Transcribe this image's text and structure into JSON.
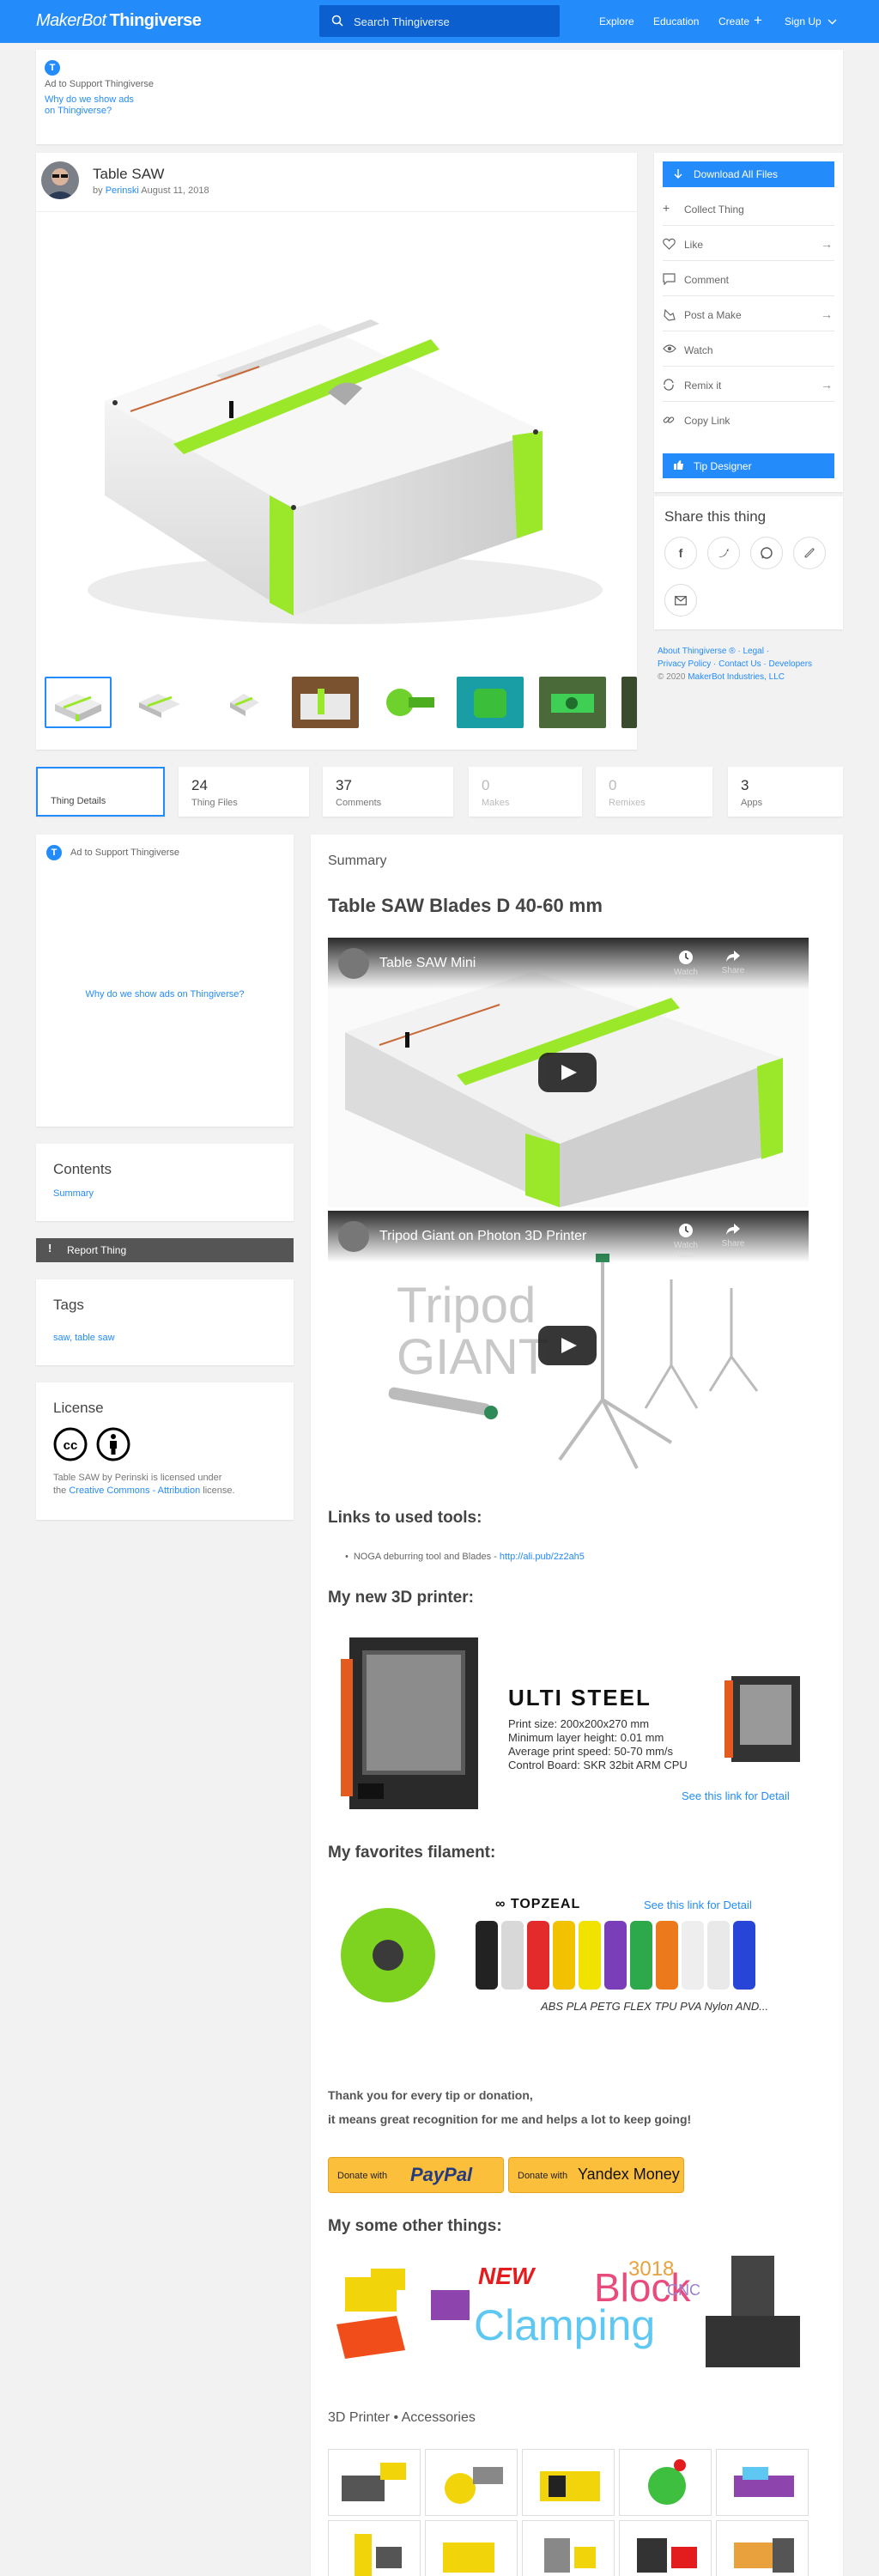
{
  "nav": {
    "logo_left": "MakerBot",
    "logo_right": "Thingiverse",
    "search_placeholder": "Search Thingiverse",
    "links": [
      "Explore",
      "Education",
      "Create",
      "Sign Up"
    ]
  },
  "ad_top": {
    "badge": "T",
    "label": "Ad to Support Thingiverse",
    "why_line1": "Why do we show ads",
    "why_line2": "on Thingiverse?"
  },
  "thing": {
    "title": "Table SAW",
    "by": "by",
    "author": "Perinski",
    "date": "August 11, 2018"
  },
  "actions": {
    "download": "Download All Files",
    "items": [
      "Collect Thing",
      "Like",
      "Comment",
      "Post a Make",
      "Watch",
      "Remix it",
      "Copy Link"
    ],
    "tip": "Tip Designer"
  },
  "share": {
    "title": "Share this thing"
  },
  "footer": {
    "line1": "About Thingiverse ® · Legal ·",
    "line2": "Privacy Policy · Contact Us · Developers",
    "line3_prefix": "© 2020",
    "line3_link": "MakerBot Industries, LLC"
  },
  "stats": [
    {
      "num": "",
      "label": "Thing Details"
    },
    {
      "num": "24",
      "label": "Thing Files"
    },
    {
      "num": "37",
      "label": "Comments"
    },
    {
      "num": "0",
      "label": "Makes"
    },
    {
      "num": "0",
      "label": "Remixes"
    },
    {
      "num": "3",
      "label": "Apps"
    }
  ],
  "ad_side": {
    "badge": "T",
    "label": "Ad to Support Thingiverse",
    "why": "Why do we show ads on Thingiverse?"
  },
  "contents": {
    "title": "Contents",
    "link": "Summary"
  },
  "report": "Report Thing",
  "tags": {
    "title": "Tags",
    "list": "saw, table saw"
  },
  "license": {
    "title": "License",
    "text1": "Table SAW by Perinski is licensed under",
    "text2_prefix": "the",
    "link": "Creative Commons - Attribution",
    "text2_suffix": "license."
  },
  "summary": {
    "label": "Summary",
    "heading": "Table SAW Blades D 40-60 mm",
    "video1_title": "Table SAW Mini",
    "video2_title": "Tripod Giant on Photon 3D Printer",
    "watch_later": "Watch later",
    "share": "Share",
    "tripod_text1": "Tripod",
    "tripod_text2": "GIANT",
    "links_heading": "Links to used tools:",
    "tool_item": "NOGA deburring tool and Blades - ",
    "tool_link": "http://ali.pub/2z2ah5",
    "printer_heading": "My new 3D printer:",
    "printer_name": "ULTI STEEL",
    "printer_specs": [
      "Print size: 200x200x270 mm",
      "Minimum layer height: 0.01 mm",
      "Average print speed: 50-70 mm/s",
      "Control Board: SKR 32bit ARM CPU"
    ],
    "printer_link": "See this link for Detail",
    "filament_heading": "My favorites filament:",
    "filament_brand": "TOPZEAL",
    "filament_link": "See this link for Detail",
    "filament_types": "ABS PLA PETG FLEX TPU PVA Nylon AND...",
    "thanks1": "Thank you for every tip or donation,",
    "thanks2": "it means great recognition for me and helps a lot to keep going!",
    "donate_with": "Donate with",
    "paypal": "PayPal",
    "yandex": "Yandex Money",
    "other_heading": "My some other things:",
    "banner_new": "NEW",
    "banner_block": "Block",
    "banner_clamping": "Clamping",
    "banner_year": "3018",
    "banner_cnc": "CNC",
    "accessories": "3D Printer • Accessories"
  },
  "colors": {
    "brand": "#248bfb",
    "accent_green": "#9be82a"
  }
}
